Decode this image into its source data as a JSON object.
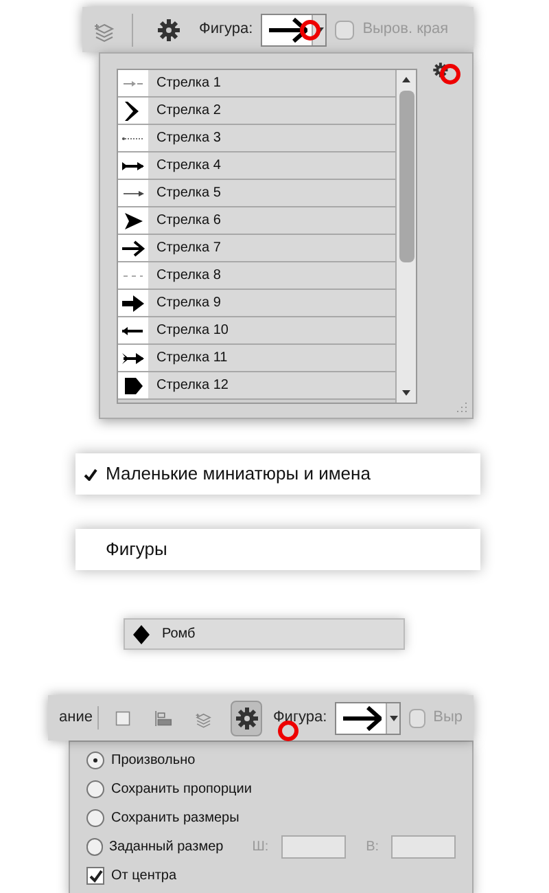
{
  "top_toolbar": {
    "shape_label": "Фигура:",
    "align_edges": {
      "label": "Выров. края",
      "checked": false,
      "disabled": true
    }
  },
  "shape_list": {
    "items": [
      {
        "label": "Стрелка 1"
      },
      {
        "label": "Стрелка 2"
      },
      {
        "label": "Стрелка 3"
      },
      {
        "label": "Стрелка 4"
      },
      {
        "label": "Стрелка 5"
      },
      {
        "label": "Стрелка 6"
      },
      {
        "label": "Стрелка 7"
      },
      {
        "label": "Стрелка 8"
      },
      {
        "label": "Стрелка 9"
      },
      {
        "label": "Стрелка 10"
      },
      {
        "label": "Стрелка 11"
      },
      {
        "label": "Стрелка 12"
      }
    ]
  },
  "menu_items": [
    {
      "label": "Маленькие миниатюры и имена",
      "checked": true
    },
    {
      "label": "Фигуры",
      "checked": false
    }
  ],
  "shape_row": {
    "label": "Ромб"
  },
  "bottom_toolbar": {
    "cut_label": "ание",
    "shape_label": "Фигура:",
    "align_edges": {
      "label": "Выр",
      "checked": false,
      "disabled": true
    }
  },
  "geometry_options": {
    "radios": [
      {
        "label": "Произвольно",
        "selected": true
      },
      {
        "label": "Сохранить пропорции",
        "selected": false
      },
      {
        "label": "Сохранить размеры",
        "selected": false
      },
      {
        "label": "Заданный размер",
        "selected": false
      }
    ],
    "width_label": "Ш:",
    "height_label": "В:",
    "from_center": {
      "label": "От центра",
      "checked": true
    }
  }
}
